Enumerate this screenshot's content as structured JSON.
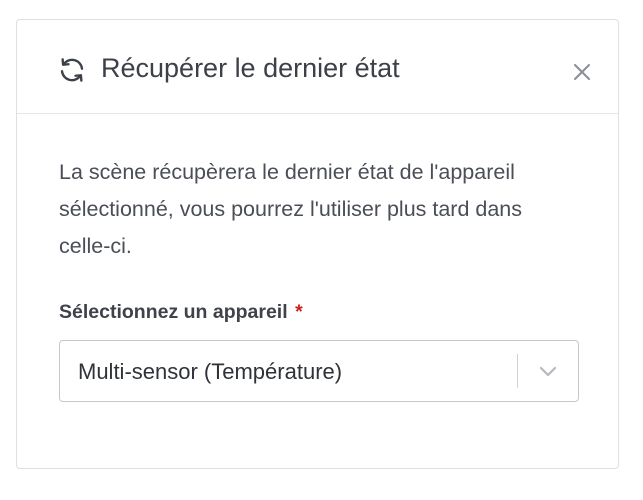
{
  "modal": {
    "title": "Récupérer le dernier état",
    "title_icon": "refresh-icon",
    "close_icon": "close-icon"
  },
  "body": {
    "description": "La scène récupèrera le dernier état de l'appareil sélectionné, vous pourrez l'utiliser plus tard dans celle-ci.",
    "device_field": {
      "label": "Sélectionnez un appareil",
      "required_marker": "*",
      "selected_value": "Multi-sensor (Température)",
      "dropdown_icon": "chevron-down-icon"
    }
  },
  "colors": {
    "required": "#cc1f1a",
    "border": "#dcdfe3",
    "text": "#495057"
  }
}
